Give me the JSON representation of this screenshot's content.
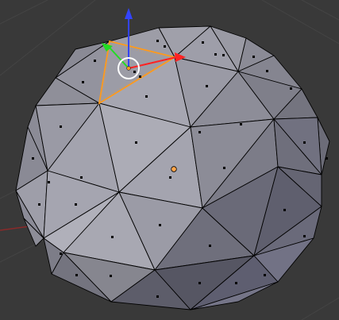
{
  "editor": {
    "type": "3d-viewport",
    "mode": "edit-mode",
    "select_mode": "face",
    "object_type": "icosphere",
    "colors": {
      "background": "#393939",
      "grid": "#444444",
      "x_axis": "#8a2a2a",
      "face_fill": "#a7a7b2",
      "edge": "#000000",
      "face_dot": "#000000",
      "selection": "#ff9a1c",
      "origin": "#ffa64a",
      "gizmo_x": "#ff2222",
      "gizmo_y": "#22dd22",
      "gizmo_z": "#3344ff",
      "pivot_ring": "#ffffff"
    }
  },
  "selection": {
    "selected_faces": 1
  },
  "gizmo": {
    "type": "translate-manipulator",
    "axes": [
      "x-arrow",
      "y-arrow",
      "z-arrow"
    ]
  }
}
